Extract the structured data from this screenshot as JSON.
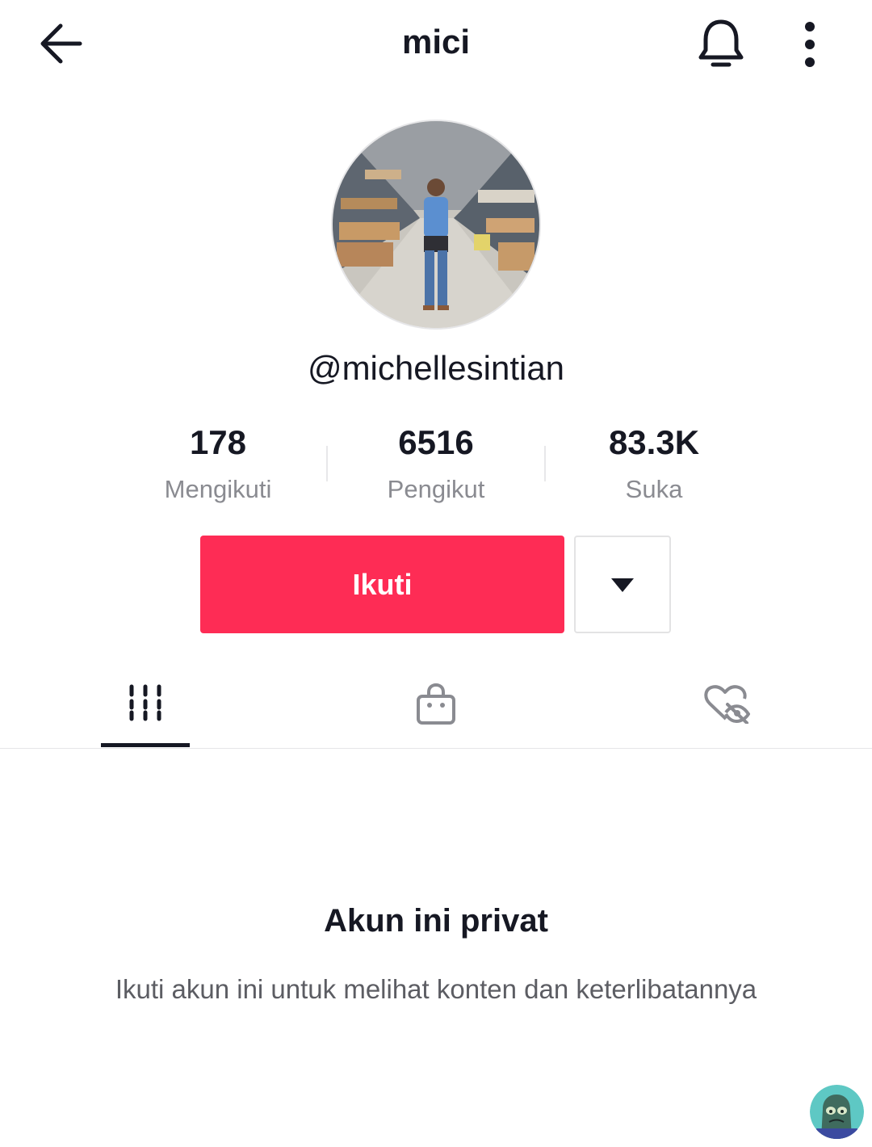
{
  "header": {
    "title": "mici",
    "back_icon": "arrow-left-icon",
    "bell_icon": "bell-icon",
    "more_icon": "more-vertical-icon"
  },
  "profile": {
    "username": "@michellesintian",
    "avatar_alt": "profile-avatar"
  },
  "stats": [
    {
      "value": "178",
      "label": "Mengikuti"
    },
    {
      "value": "6516",
      "label": "Pengikut"
    },
    {
      "value": "83.3K",
      "label": "Suka"
    }
  ],
  "actions": {
    "follow_label": "Ikuti",
    "follow_color": "#fe2c55",
    "dropdown_icon": "caret-down-icon"
  },
  "tabs": [
    {
      "icon": "videos-grid-icon",
      "active": true
    },
    {
      "icon": "shopping-bag-icon",
      "active": false
    },
    {
      "icon": "liked-hidden-icon",
      "active": false
    }
  ],
  "private_notice": {
    "title": "Akun ini privat",
    "description": "Ikuti akun ini untuk melihat konten dan keterlibatannya"
  }
}
